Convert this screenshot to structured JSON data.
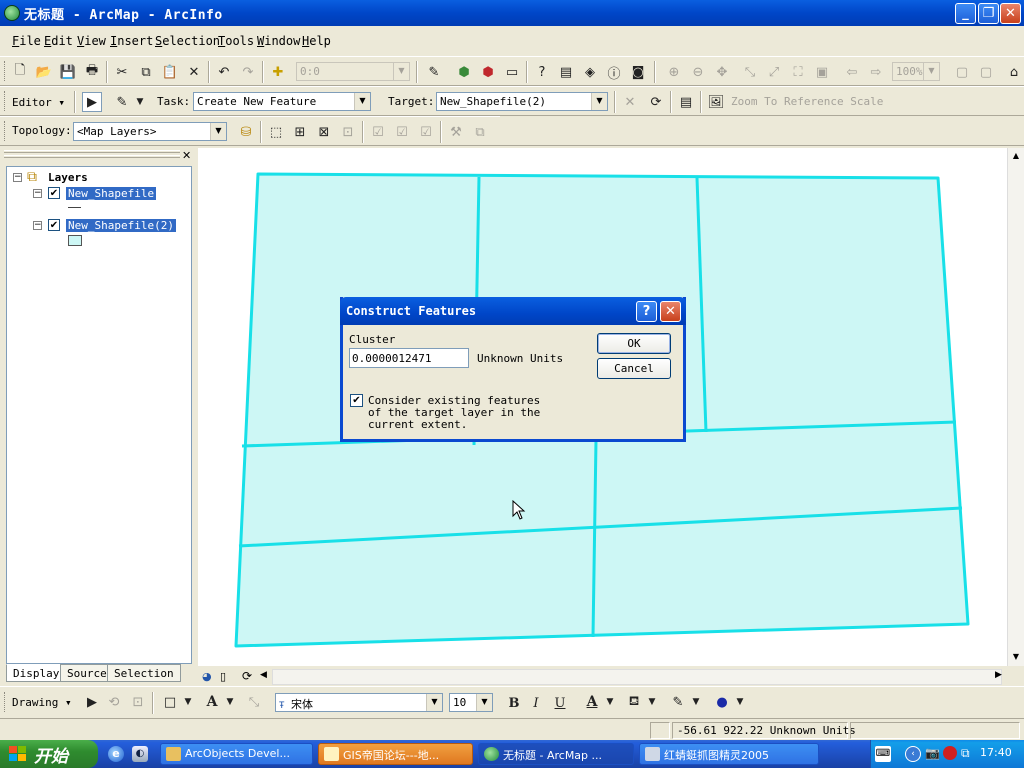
{
  "window": {
    "title": "无标题 - ArcMap - ArcInfo"
  },
  "menubar": {
    "items": [
      {
        "u": "F",
        "rest": "ile"
      },
      {
        "u": "E",
        "rest": "dit"
      },
      {
        "u": "V",
        "rest": "iew"
      },
      {
        "u": "I",
        "rest": "nsert"
      },
      {
        "u": "S",
        "rest": "election"
      },
      {
        "u": "T",
        "rest": "ools"
      },
      {
        "u": "W",
        "rest": "indow"
      },
      {
        "u": "H",
        "rest": "elp"
      }
    ]
  },
  "standard_toolbar": {
    "scale_value": "0:0",
    "zoom_value": "100%"
  },
  "editor_toolbar": {
    "editor_label": "Editor",
    "task_label": "Task:",
    "task_value": "Create New Feature",
    "target_label": "Target:",
    "target_value": "New_Shapefile(2)",
    "zoom_ref_label": "Zoom To Reference Scale"
  },
  "topology_toolbar": {
    "label": "Topology:",
    "value": "<Map Layers>"
  },
  "toc": {
    "root_label": "Layers",
    "layers": [
      {
        "name": "New_Shapefile",
        "checked": true,
        "symbol": "line"
      },
      {
        "name": "New_Shapefile(2)",
        "checked": true,
        "symbol": "polygon"
      }
    ],
    "tabs": [
      "Display",
      "Source",
      "Selection"
    ]
  },
  "map": {
    "fill_color": "#cdf7f5",
    "stroke_color": "#18e0e8"
  },
  "dialog": {
    "title": "Construct Features",
    "cluster_label": "Cluster",
    "cluster_value": "0.0000012471",
    "units_label": "Unknown Units",
    "checkbox_checked": true,
    "checkbox_line1": "Consider existing features",
    "checkbox_line2": "of the target layer in the",
    "checkbox_line3": "current extent.",
    "ok_label": "OK",
    "cancel_label": "Cancel"
  },
  "drawing_toolbar": {
    "drawing_label": "Drawing",
    "font_name": "宋体",
    "font_size": "10"
  },
  "statusbar": {
    "coordinates": "-56.61  922.22 Unknown Units"
  },
  "taskbar": {
    "start_label": "开始",
    "tasks": [
      {
        "label": "ArcObjects Devel...",
        "active": false
      },
      {
        "label": "GIS帝国论坛---地...",
        "active": false
      },
      {
        "label": "无标题 - ArcMap ...",
        "active": true
      },
      {
        "label": "红蜻蜓抓图精灵2005",
        "active": false
      }
    ],
    "clock": "17:40"
  }
}
